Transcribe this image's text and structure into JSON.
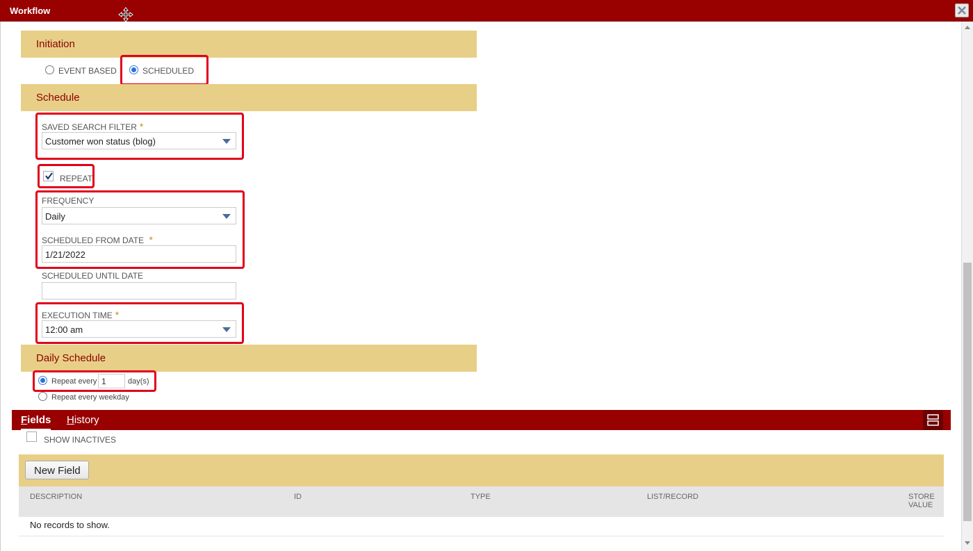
{
  "window": {
    "title": "Workflow"
  },
  "initiation": {
    "header": "Initiation",
    "options": [
      "EVENT BASED",
      "SCHEDULED"
    ],
    "selected": "SCHEDULED"
  },
  "schedule": {
    "header": "Schedule",
    "saved_search_label": "SAVED SEARCH FILTER",
    "saved_search_value": "Customer won status (blog)",
    "repeat_label": "REPEAT",
    "repeat_checked": true,
    "frequency_label": "FREQUENCY",
    "frequency_value": "Daily",
    "from_date_label": "SCHEDULED FROM DATE",
    "from_date_value": "1/21/2022",
    "until_date_label": "SCHEDULED UNTIL DATE",
    "until_date_value": "",
    "execution_time_label": "EXECUTION TIME",
    "execution_time_value": "12:00 am",
    "required_mark": "*"
  },
  "daily_schedule": {
    "header": "Daily Schedule",
    "repeat_every_label": "Repeat every",
    "repeat_every_value": "1",
    "unit": "day(s)",
    "weekday_label": "Repeat every weekday",
    "selected": "Repeat every"
  },
  "tabs": {
    "fields": {
      "first": "F",
      "rest": "ields"
    },
    "history": {
      "first": "H",
      "rest": "istory"
    },
    "active": "Fields"
  },
  "fields_panel": {
    "show_inactives_label": "SHOW INACTIVES",
    "new_field_button": "New Field",
    "columns": [
      "DESCRIPTION",
      "ID",
      "TYPE",
      "LIST/RECORD",
      "STORE",
      "VALUE"
    ],
    "empty_message": "No records to show."
  },
  "colors": {
    "titlebar": "#990000",
    "section": "#e8cf87",
    "section_text": "#8b0000",
    "highlight": "#e0001b"
  }
}
